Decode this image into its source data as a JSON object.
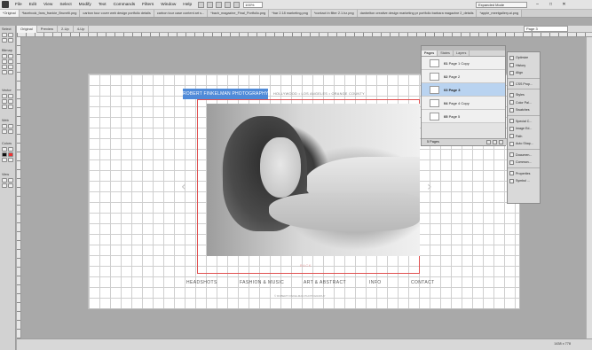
{
  "app": {
    "menu": [
      "File",
      "Edit",
      "View",
      "Select",
      "Modify",
      "Text",
      "Commands",
      "Filters",
      "Window",
      "Help"
    ],
    "zoom": "100%",
    "workspace_mode": "Expanded Mode"
  },
  "doc_tabs": [
    "*Original",
    "*facebook_fans_frankie_Brunelli.png",
    "carbon tour cover web design portfolio details",
    "carbon tour case content art s...",
    "*bach_magazine_Final_Portfolio.png",
    "*bar 2.18 marketing.png",
    "*contact in filter 2.1.hz.png",
    "danbelton creative design marketing pr portfolio barbara magazine 2_details",
    "*apple_meetgallery.ai.png"
  ],
  "page_selector": "Page 3",
  "view_buttons": [
    "Original",
    "Preview",
    "2-Up",
    "4-Up"
  ],
  "toolbox": {
    "sections": [
      "Select",
      "Bitmap",
      "Vector",
      "Web",
      "Colors",
      "View"
    ]
  },
  "website": {
    "logo": "ROBERT FINKELMAN PHOTOGRAPHY",
    "breadcrumb": "HOLLYWOOD  •  LOS ANGELES  •  ORANGE COUNTY",
    "back_label": "BACK",
    "nav": [
      "HEADSHOTS",
      "FASHION & MUSIC",
      "ART & ABSTRACT",
      "INFO",
      "CONTACT"
    ],
    "copyright": "© ROBERT FINKELMAN PHOTOGRAPHY",
    "prev_arrow": "‹",
    "next_arrow": "›"
  },
  "pages_panel": {
    "tabs": [
      "Pages",
      "States",
      "Layers"
    ],
    "pages": [
      {
        "num": "01",
        "name": "Page 1 Copy"
      },
      {
        "num": "02",
        "name": "Page 2"
      },
      {
        "num": "03",
        "name": "Page 3"
      },
      {
        "num": "04",
        "name": "Page 4 Copy"
      },
      {
        "num": "05",
        "name": "Page 5"
      }
    ],
    "selected_page": 3,
    "footer": "5 Pages"
  },
  "dock": [
    "Optimize",
    "History",
    "Align",
    "CSS Prop...",
    "Styles",
    "Color Pal...",
    "Swatches",
    "Special C...",
    "Image Ed...",
    "Path",
    "Auto Shap...",
    "Documen...",
    "Common...",
    "Properties",
    "Symbol ..."
  ],
  "status": {
    "canvas_size": "1438 x 778"
  }
}
